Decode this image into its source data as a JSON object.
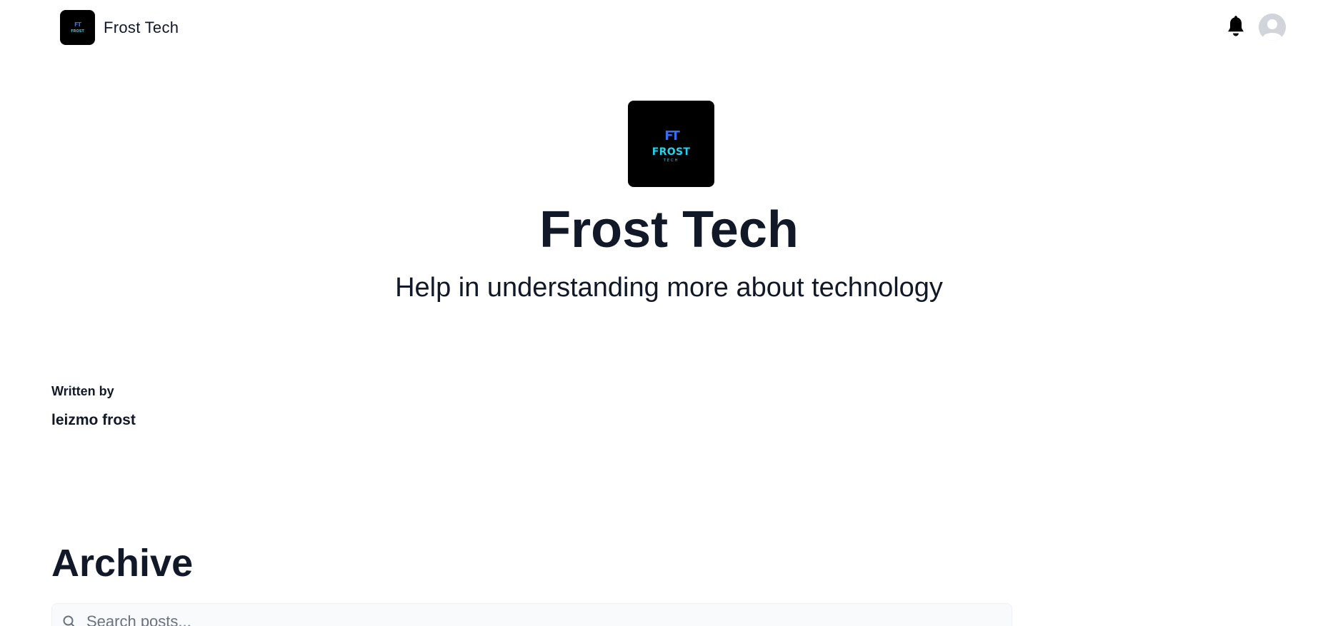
{
  "header": {
    "brand_name": "Frost Tech",
    "brand_logo": {
      "monogram": "FT",
      "wordmark": "FROST"
    },
    "icons": {
      "notifications": "bell-icon",
      "profile": "user-avatar"
    }
  },
  "hero": {
    "logo": {
      "monogram": "FT",
      "wordmark": "FROST",
      "subtext": "TECH"
    },
    "title": "Frost Tech",
    "tagline": "Help in understanding more about technology"
  },
  "author": {
    "label": "Written by",
    "name": "leizmo frost"
  },
  "archive": {
    "title": "Archive",
    "search_placeholder": "Search posts..."
  },
  "colors": {
    "text": "#111827",
    "logo_bg": "#000000",
    "logo_monogram": "#3b6cf0",
    "logo_wordmark": "#22d3ee",
    "search_bg": "#f8fafc"
  }
}
